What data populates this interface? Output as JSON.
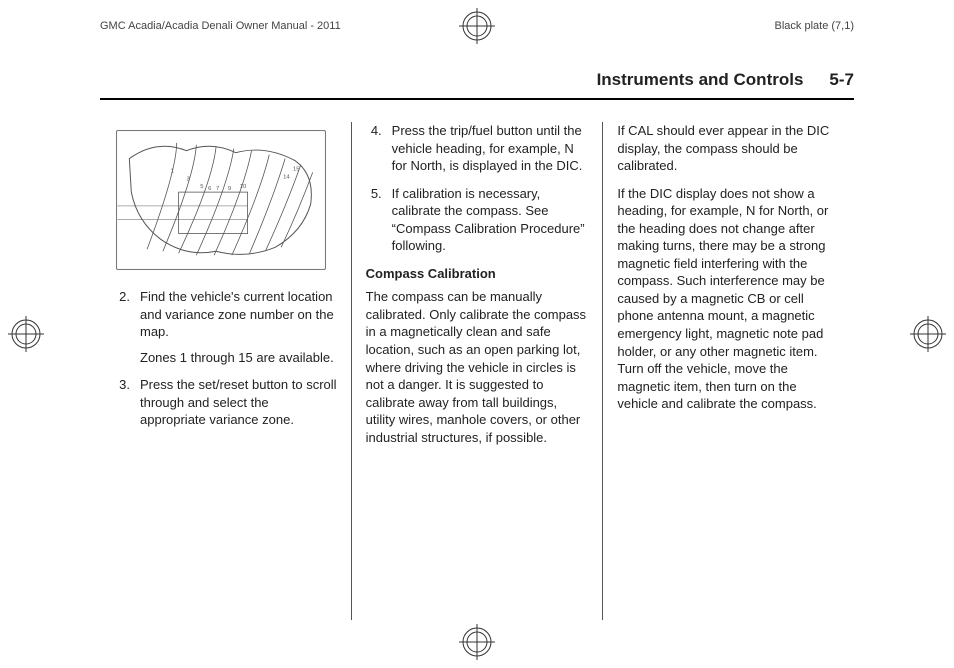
{
  "top": {
    "doc_title": "GMC Acadia/Acadia Denali Owner Manual - 2011",
    "plate": "Black plate (7,1)"
  },
  "header": {
    "section": "Instruments and Controls",
    "page": "5-7"
  },
  "col1": {
    "map_alt": "compass-variance-zone-map",
    "steps": [
      {
        "n": "2.",
        "text": "Find the vehicle's current location and variance zone number on the map.",
        "sub": "Zones 1 through 15 are available."
      },
      {
        "n": "3.",
        "text": "Press the set/reset button to scroll through and select the appropriate variance zone."
      }
    ]
  },
  "col2": {
    "steps": [
      {
        "n": "4.",
        "text": "Press the trip/fuel button until the vehicle heading, for example, N for North, is displayed in the DIC."
      },
      {
        "n": "5.",
        "text": "If calibration is necessary, calibrate the compass. See “Compass Calibration Procedure” following."
      }
    ],
    "subhead": "Compass Calibration",
    "para": "The compass can be manually calibrated. Only calibrate the compass in a magnetically clean and safe location, such as an open parking lot, where driving the vehicle in circles is not a danger. It is suggested to calibrate away from tall buildings, utility wires, manhole covers, or other industrial structures, if possible."
  },
  "col3": {
    "p1": "If CAL should ever appear in the DIC display, the compass should be calibrated.",
    "p2": "If the DIC display does not show a heading, for example, N for North, or the heading does not change after making turns, there may be a strong magnetic field interfering with the compass. Such interference may be caused by a magnetic CB or cell phone antenna mount, a magnetic emergency light, magnetic note pad holder, or any other magnetic item. Turn off the vehicle, move the magnetic item, then turn on the vehicle and calibrate the compass."
  }
}
